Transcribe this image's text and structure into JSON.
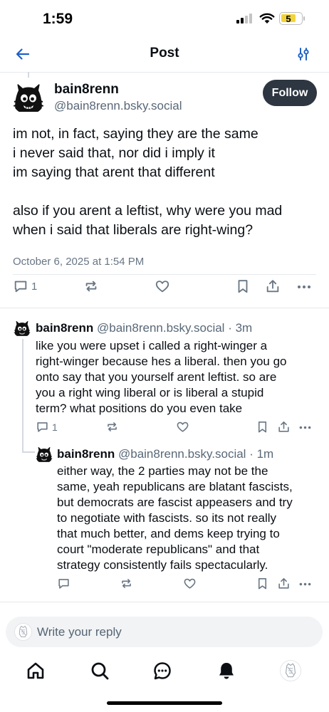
{
  "status_bar": {
    "time": "1:59",
    "battery_level": "5"
  },
  "header": {
    "title": "Post"
  },
  "main_post": {
    "author_name": "bain8renn",
    "author_handle": "@bain8renn.bsky.social",
    "follow_label": "Follow",
    "text_paragraphs": [
      [
        "im not, in fact, saying they are the same",
        "i never said that, nor did i imply it",
        "im saying that arent that different"
      ],
      [
        "also if you arent a leftist, why were you mad",
        "when i said that liberals are right-wing?"
      ]
    ],
    "timestamp": "October 6, 2025 at 1:54 PM",
    "reply_count": "1"
  },
  "replies": [
    {
      "author_name": "bain8renn",
      "author_handle": "@bain8renn.bsky.social",
      "age": "· 3m",
      "text_lines": [
        "like you were upset i called a right-winger a",
        "right-winger because hes a liberal. then you go",
        "onto say that you yourself arent leftist. so are",
        "you a right wing liberal or is liberal a stupid",
        "term? what positions do you even take"
      ],
      "reply_count": "1"
    },
    {
      "author_name": "bain8renn",
      "author_handle": "@bain8renn.bsky.social",
      "age": "· 1m",
      "text_lines": [
        "either way, the 2 parties may not be the",
        "same, yeah republicans are blatant fascists,",
        "but democrats are fascist appeasers and try",
        "to negotiate with fascists. so its not really",
        "that much better, and dems keep trying to",
        "court \"moderate republicans\" and that",
        "strategy consistently fails spectacularly."
      ],
      "reply_count": ""
    }
  ],
  "composer": {
    "placeholder": "Write your reply"
  },
  "colors": {
    "accent": "#2d3641",
    "muted": "#687684",
    "divider": "#e6e9ee",
    "thread_line": "#d4d9e0",
    "battery": "#f2d43a"
  },
  "icons": {
    "header": [
      "back-arrow-icon",
      "sliders-icon"
    ],
    "actions": [
      "reply-icon",
      "repost-icon",
      "like-icon",
      "bookmark-icon",
      "share-icon",
      "more-icon"
    ],
    "tabs": [
      "home-icon",
      "search-icon",
      "chat-icon",
      "notifications-icon",
      "profile-avatar"
    ]
  }
}
